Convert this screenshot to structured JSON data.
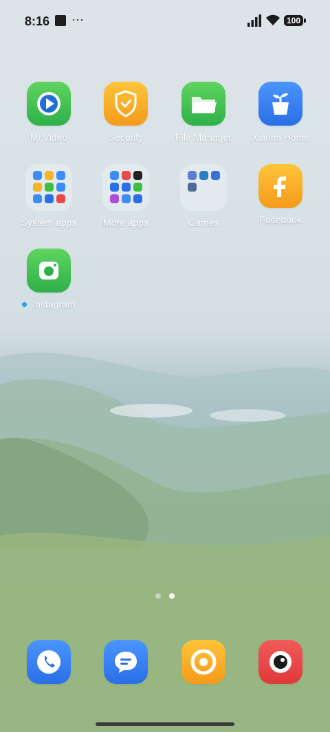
{
  "status_bar": {
    "time": "8:16",
    "more_indicator": "···",
    "battery": "100",
    "icons": [
      "signal-icon",
      "wifi-icon",
      "battery-icon"
    ]
  },
  "home": {
    "row1": [
      {
        "label": "Mi Video",
        "icon": "play-icon",
        "color": "#3fbf3f"
      },
      {
        "label": "Security",
        "icon": "shield-icon",
        "color": "#f5a623"
      },
      {
        "label": "File Manager",
        "icon": "folder-icon",
        "color": "#3fbf3f"
      },
      {
        "label": "Xiaomi Home",
        "icon": "plant-pot-icon",
        "color": "#2f7fef"
      }
    ],
    "row2": [
      {
        "label": "System apps"
      },
      {
        "label": "More apps"
      },
      {
        "label": "Games"
      },
      {
        "label": "Facebook",
        "icon": "f-icon",
        "color": "#f5b52b"
      }
    ],
    "row3": [
      {
        "label": "Instagram",
        "icon": "camera-icon",
        "color": "#3fbf3f",
        "new_indicator": true
      }
    ]
  },
  "pager": {
    "pages": 2,
    "current": 2
  },
  "dock": [
    {
      "name": "phone",
      "icon": "phone-icon",
      "color": "#2f7fef"
    },
    {
      "name": "messages",
      "icon": "chat-bubble-icon",
      "color": "#2f7fef"
    },
    {
      "name": "browser",
      "icon": "chrome-icon",
      "color": "#f5b52b"
    },
    {
      "name": "camera",
      "icon": "camera-lens-icon",
      "color": "#ea4a4a"
    }
  ]
}
